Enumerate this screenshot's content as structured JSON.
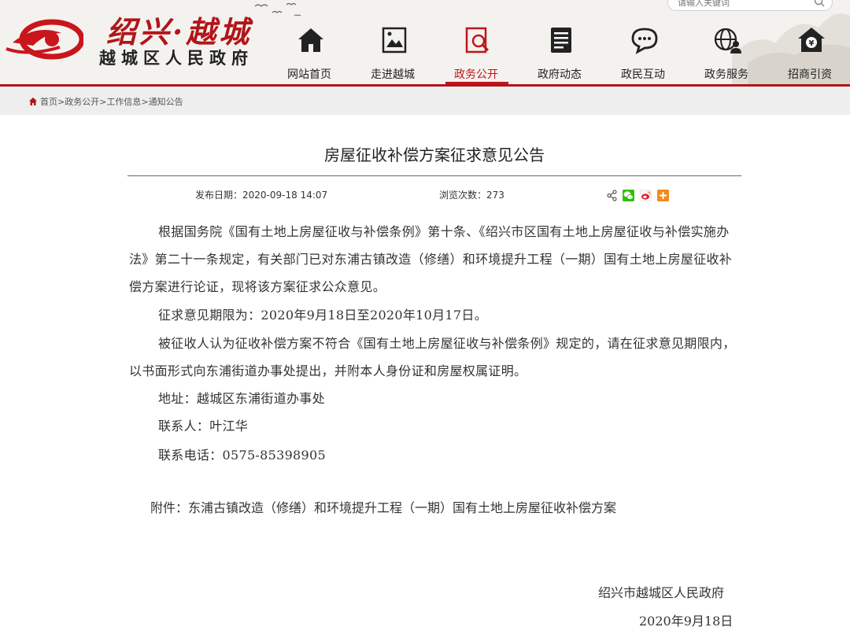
{
  "site": {
    "title": "绍兴·越城",
    "subtitle": "越城区人民政府"
  },
  "search": {
    "placeholder": "请输入关键词"
  },
  "nav": {
    "items": [
      {
        "label": "网站首页",
        "icon": "home-icon"
      },
      {
        "label": "走进越城",
        "icon": "picture-icon"
      },
      {
        "label": "政务公开",
        "icon": "document-search-icon",
        "active": true
      },
      {
        "label": "政府动态",
        "icon": "news-list-icon"
      },
      {
        "label": "政民互动",
        "icon": "chat-bubble-icon"
      },
      {
        "label": "政务服务",
        "icon": "globe-user-icon"
      },
      {
        "label": "招商引资",
        "icon": "yuan-house-icon"
      }
    ]
  },
  "breadcrumb": {
    "items": [
      "首页",
      "政务公开",
      "工作信息",
      "通知公告"
    ],
    "separator": ">"
  },
  "article": {
    "title": "房屋征收补偿方案征求意见公告",
    "date_label": "发布日期：",
    "date_value": "2020-09-18 14:07",
    "views_label": "浏览次数：",
    "views_value": "273",
    "paragraphs": {
      "main": "根据国务院《国有土地上房屋征收与补偿条例》第十条、《绍兴市区国有土地上房屋征收与补偿实施办法》第二十一条规定，有关部门已对东浦古镇改造（修缮）和环境提升工程（一期）国有土地上房屋征收补偿方案进行论证，现将该方案征求公众意见。",
      "period": "征求意见期限为：2020年9月18日至2020年10月17日。",
      "rights": "被征收人认为征收补偿方案不符合《国有土地上房屋征收与补偿条例》规定的，请在征求意见期限内，以书面形式向东浦街道办事处提出，并附本人身份证和房屋权属证明。",
      "address": "地址：越城区东浦街道办事处",
      "contact": "联系人：叶江华",
      "phone": "联系电话：0575-85398905"
    },
    "attachment": "附件：东浦古镇改造（修缮）和环境提升工程（一期）国有土地上房屋征收补偿方案",
    "sign_org": "绍兴市越城区人民政府",
    "sign_date": "2020年9月18日"
  },
  "colors": {
    "brand_red": "#b1151a",
    "active_red": "#c0151b",
    "wechat_green": "#2dc100",
    "weibo_red": "#e6162d",
    "more_orange": "#f28a1a"
  },
  "share_icons": [
    "share-icon",
    "wechat-icon",
    "weibo-icon",
    "more-plus-icon"
  ]
}
